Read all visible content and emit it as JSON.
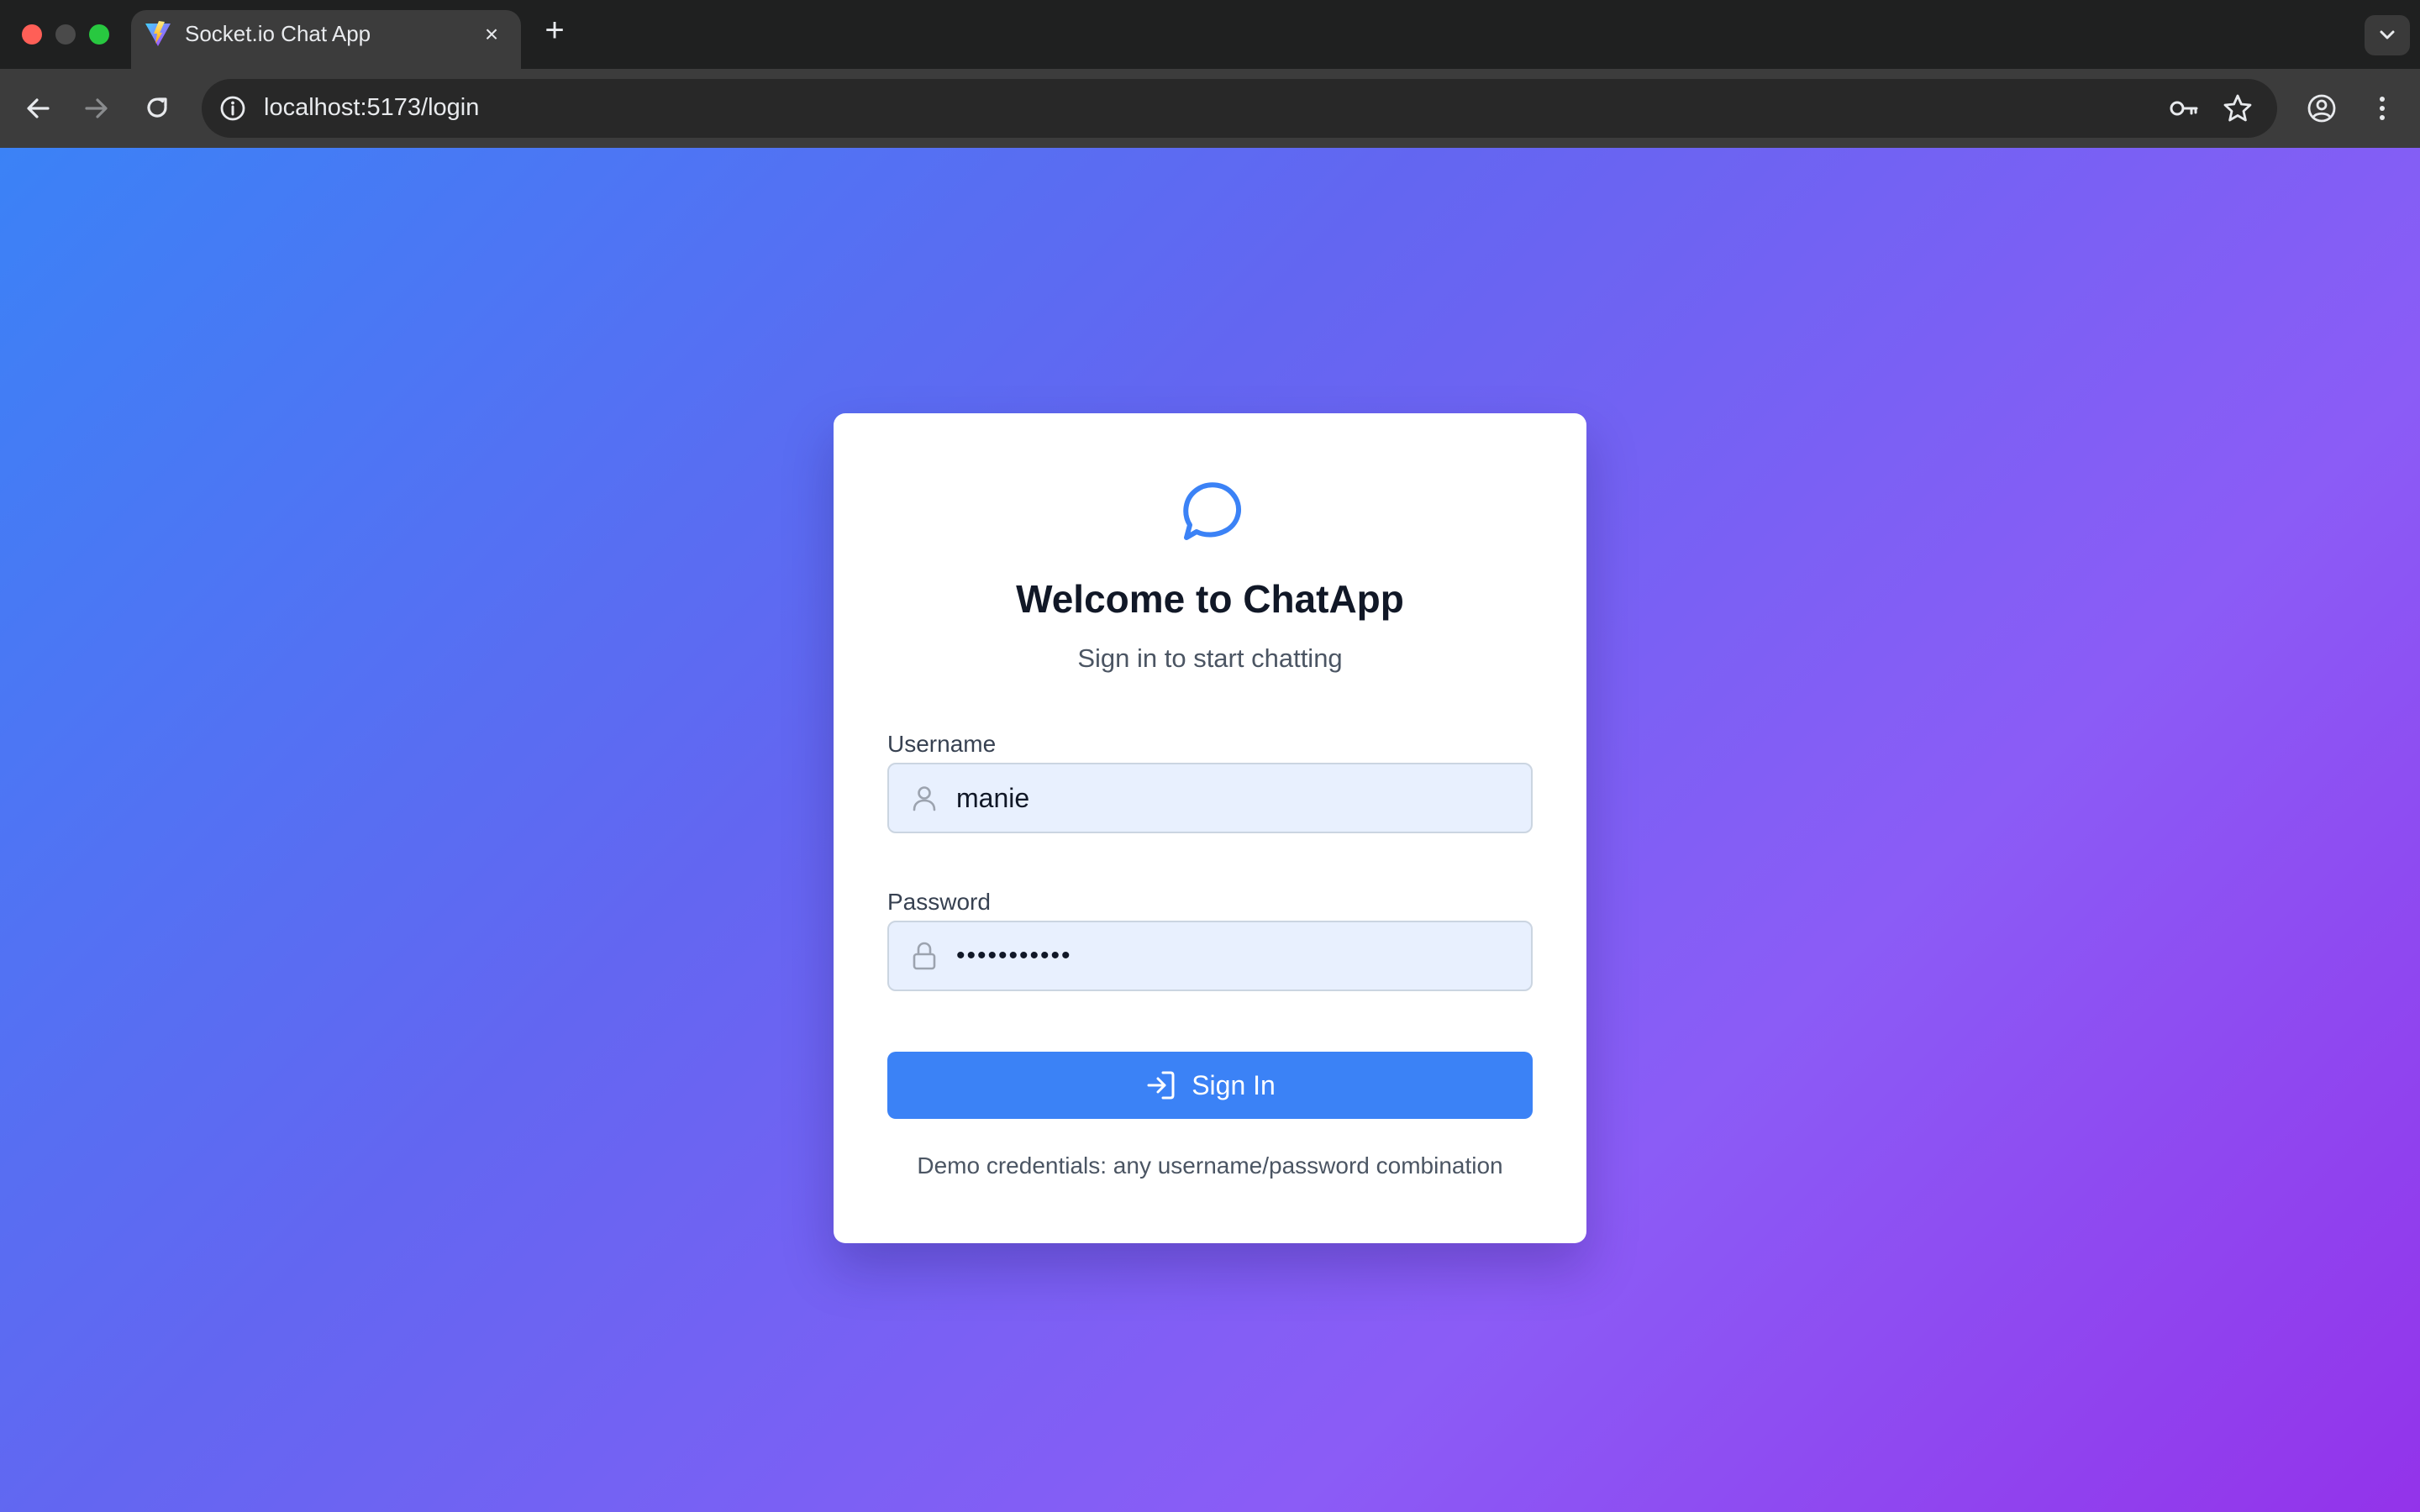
{
  "browser": {
    "tab": {
      "title": "Socket.io Chat App",
      "favicon": "vite-logo-icon",
      "close": "×"
    },
    "new_tab": "+",
    "url": "localhost:5173/login",
    "icons": {
      "back": "back-arrow-icon",
      "forward": "forward-arrow-icon",
      "reload": "reload-icon",
      "site_info": "info-icon",
      "password_key": "key-icon",
      "bookmark": "star-icon",
      "profile": "profile-icon",
      "menu": "kebab-menu-icon",
      "tab_search": "chevron-down-icon"
    }
  },
  "login": {
    "logo": "chat-bubble-icon",
    "title": "Welcome to ChatApp",
    "subtitle": "Sign in to start chatting",
    "username_label": "Username",
    "username_value": "manie",
    "password_label": "Password",
    "password_value": "•••••••••••",
    "submit_label": "Sign In",
    "demo_note": "Demo credentials: any username/password combination"
  },
  "colors": {
    "accent": "#3b82f6",
    "gradient_start": "#3b82f6",
    "gradient_end": "#9333ea",
    "input_fill": "#e8f0fe"
  }
}
